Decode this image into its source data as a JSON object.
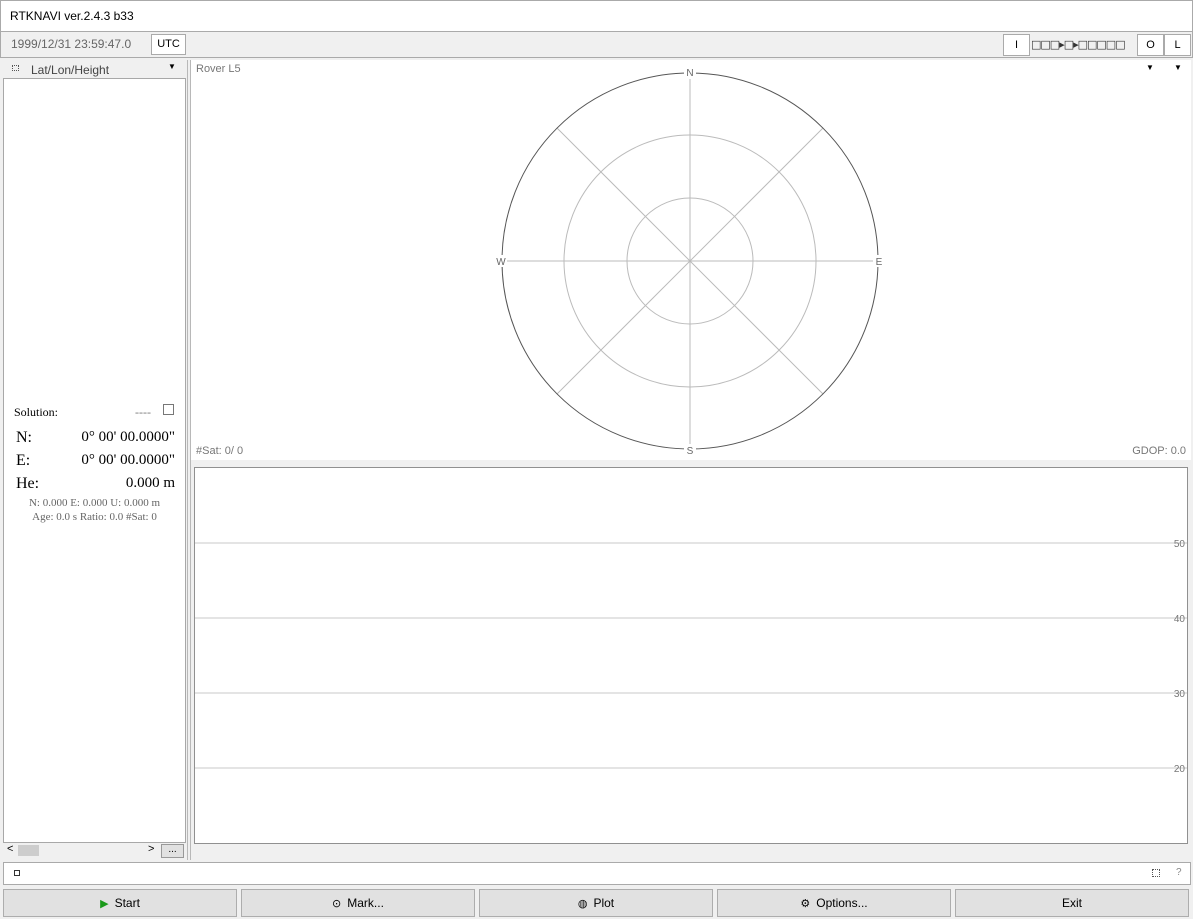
{
  "window": {
    "title": "RTKNAVI ver.2.4.3 b33"
  },
  "status": {
    "time": "1999/12/31 23:59:47.0",
    "utc_label": "UTC",
    "input_label": "I",
    "stream_indicator": "□□□▸□▸□□□□□",
    "output_label": "O",
    "log_label": "L"
  },
  "solution_panel": {
    "format": "Lat/Lon/Height",
    "solution_label": "Solution:",
    "solution_status": "----",
    "n_label": "N:",
    "n_value": "0° 00' 00.0000\"",
    "e_label": "E:",
    "e_value": "0° 00' 00.0000\"",
    "h_label": "He:",
    "h_value": "0.000 m",
    "stats_line1": "N: 0.000 E: 0.000 U: 0.000 m",
    "stats_line2": "Age: 0.0 s Ratio: 0.0 #Sat: 0",
    "more_button": "..."
  },
  "skyplot": {
    "title": "Rover L5",
    "compass": {
      "n": "N",
      "e": "E",
      "s": "S",
      "w": "W"
    },
    "sat_count": "#Sat: 0/ 0",
    "gdop": "GDOP: 0.0"
  },
  "chart_data": {
    "type": "bar",
    "title": "",
    "categories": [],
    "values": [],
    "ylim": [
      10,
      60
    ],
    "yticks": [
      "50",
      "40",
      "30",
      "20"
    ],
    "grid": true
  },
  "buttons": {
    "start": "Start",
    "mark": "Mark...",
    "plot": "Plot",
    "options": "Options...",
    "exit": "Exit"
  },
  "colors": {
    "start_icon": "#1a9a1a"
  }
}
